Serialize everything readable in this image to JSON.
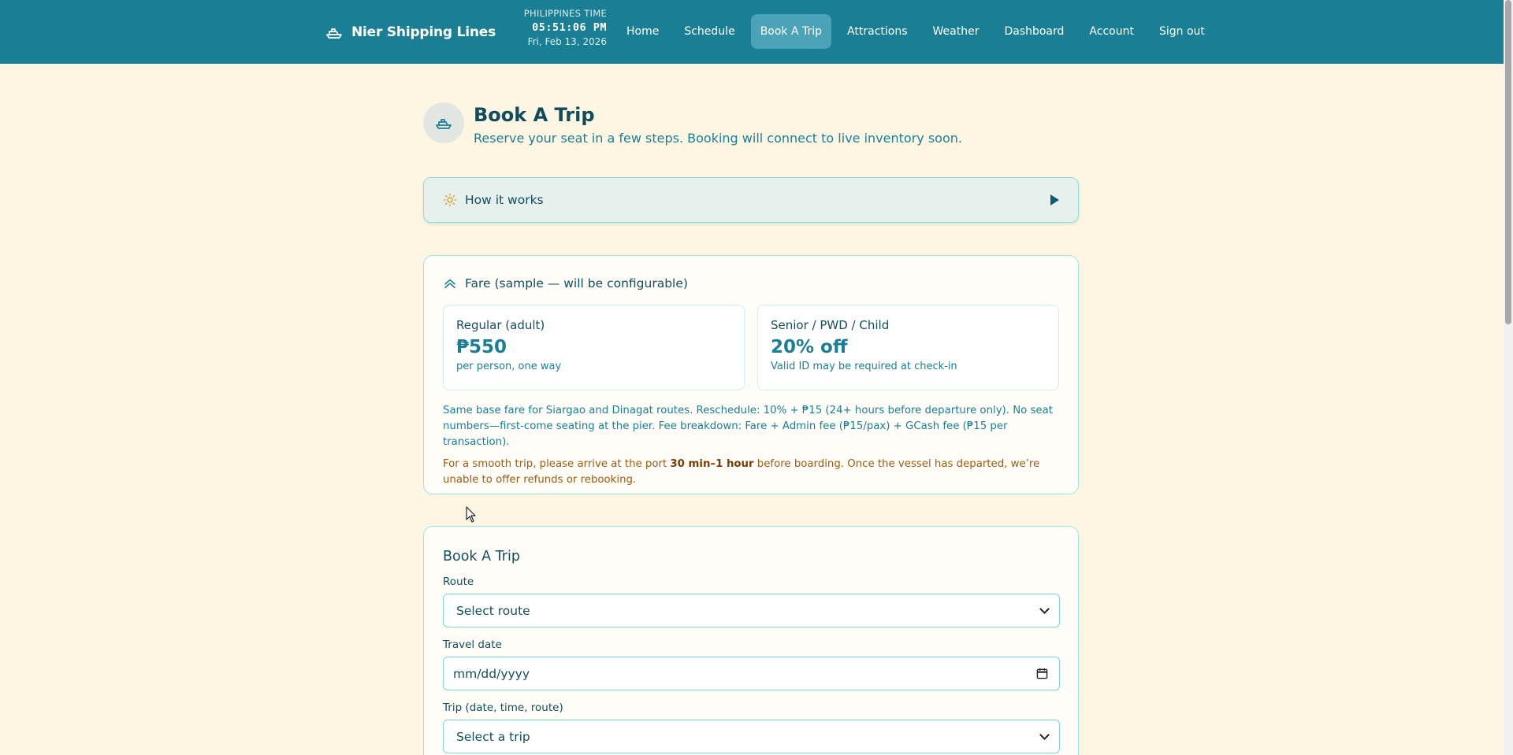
{
  "header": {
    "brand": "Nier Shipping Lines",
    "clock_label": "PHILIPPINES TIME",
    "clock_time": "05:51:06 PM",
    "clock_date": "Fri, Feb 13, 2026",
    "nav": [
      "Home",
      "Schedule",
      "Book A Trip",
      "Attractions",
      "Weather",
      "Dashboard",
      "Account",
      "Sign out"
    ],
    "active_nav": "Book A Trip",
    "color": "#1a7f94"
  },
  "page": {
    "title": "Book A Trip",
    "subtitle": "Reserve your seat in a few steps. Booking will connect to live inventory soon."
  },
  "how_it_works": {
    "label": "How it works"
  },
  "fare": {
    "title": "Fare (sample — will be configurable)",
    "regular": {
      "label": "Regular (adult)",
      "value": "₱550",
      "note": "per person, one way"
    },
    "discount": {
      "label": "Senior / PWD / Child",
      "value": "20% off",
      "note": "Valid ID may be required at check-in"
    },
    "note": "Same base fare for Siargao and Dinagat routes. Reschedule: 10% + ₱15 (24+ hours before departure only). No seat numbers—first-come seating at the pier. Fee breakdown: Fare + Admin fee (₱15/pax) + GCash fee (₱15 per transaction).",
    "warning_prefix": "For a smooth trip, please arrive at the port ",
    "warning_bold": "30 min–1 hour",
    "warning_suffix": " before boarding. Once the vessel has departed, we’re unable to offer refunds or rebooking."
  },
  "booking": {
    "title": "Book A Trip",
    "route_label": "Route",
    "route_value": "Select route",
    "date_label": "Travel date",
    "date_placeholder": "mm/dd/yyyy",
    "trip_label": "Trip (date, time, route)",
    "trip_value": "Select a trip"
  }
}
